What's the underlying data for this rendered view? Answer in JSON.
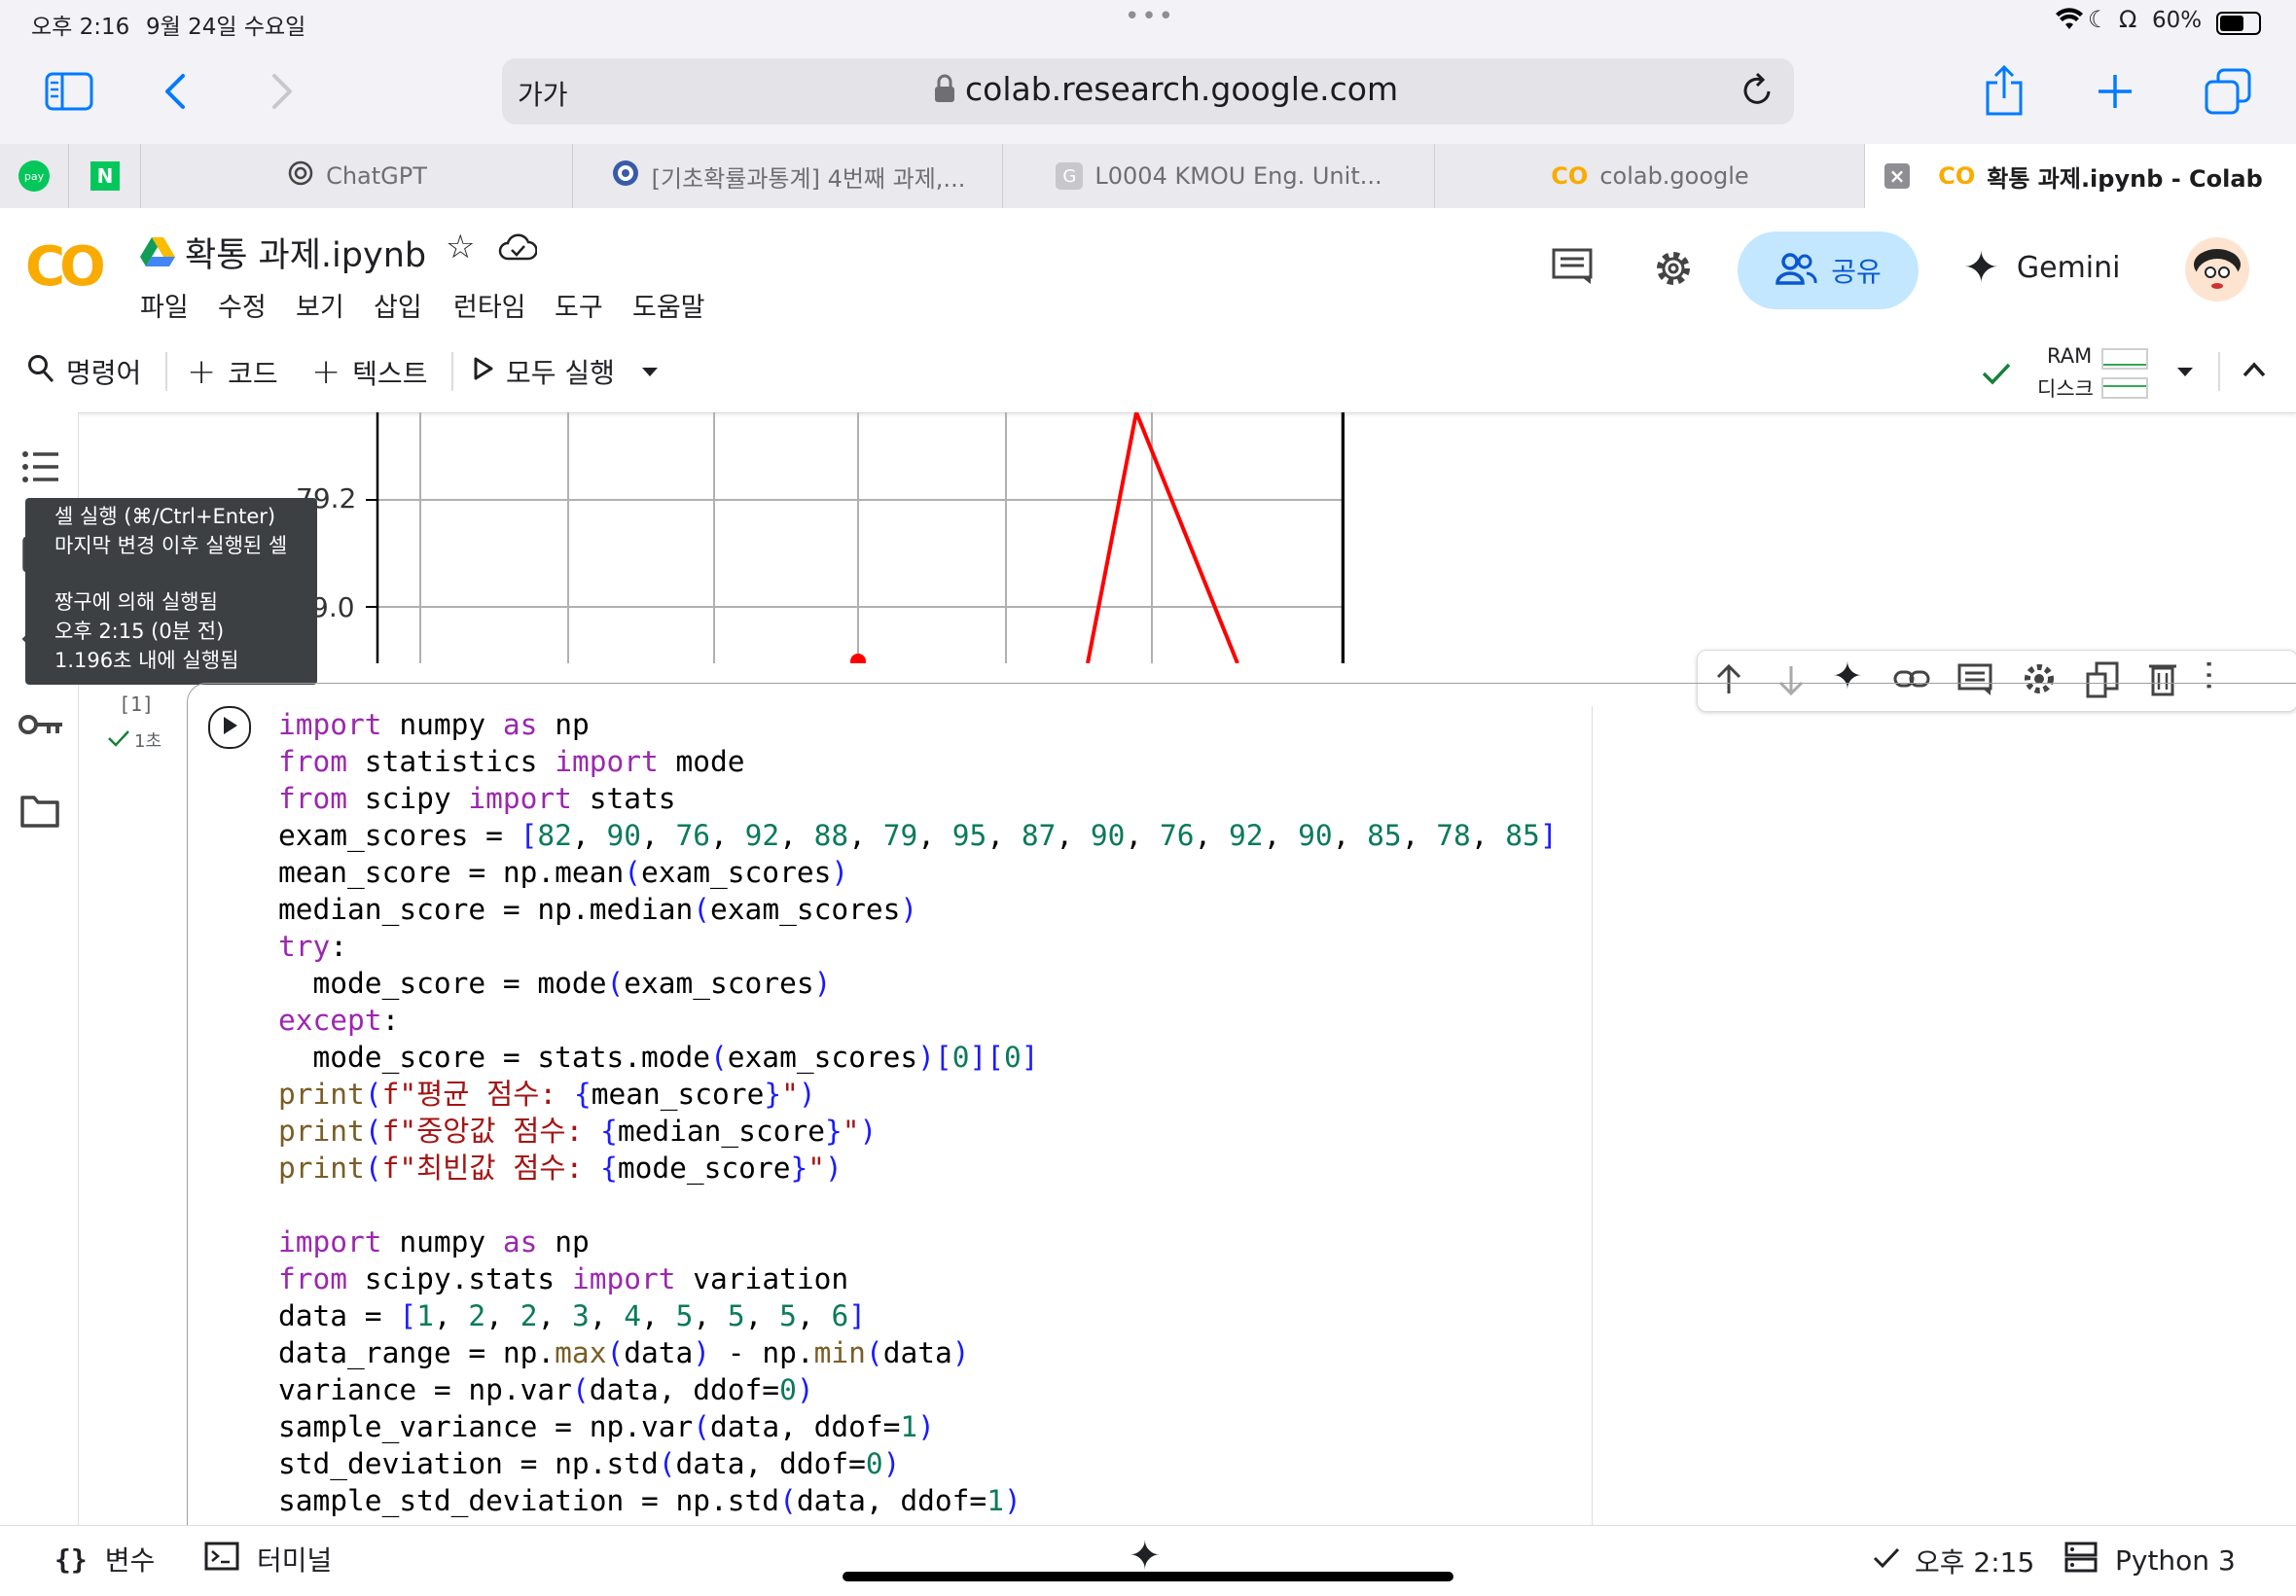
{
  "status": {
    "time": "오후 2:16",
    "date": "9월 24일 수요일",
    "battery": "60%"
  },
  "browser": {
    "aa_label": "가가",
    "url": "colab.research.google.com"
  },
  "tabs": [
    {
      "label": "ChatGPT"
    },
    {
      "label": "[기초확률과통계] 4번째 과제,..."
    },
    {
      "label": "L0004 KMOU Eng. Unit..."
    },
    {
      "label": "colab.google"
    },
    {
      "label": "확통 과제.ipynb - Colab"
    }
  ],
  "pinned": {
    "pay_label": "pay",
    "n_label": "N"
  },
  "colab": {
    "logo": "CO",
    "notebook_title": "확통 과제.ipynb",
    "menu": [
      "파일",
      "수정",
      "보기",
      "삽입",
      "런타임",
      "도구",
      "도움말"
    ],
    "share_label": "공유",
    "gemini_label": "Gemini"
  },
  "toolbar": {
    "command_label": "명령어",
    "code_label": "코드",
    "text_label": "텍스트",
    "run_all_label": "모두 실행",
    "ram_label": "RAM",
    "disk_label": "디스크"
  },
  "plot": {
    "tick_upper": "79.2",
    "tick_lower": "9.0",
    "line_color": "#ff0000"
  },
  "tooltip": {
    "line1": "셀 실행 (⌘/Ctrl+Enter)",
    "line2": "마지막 변경 이후 실행된 셀",
    "line3": "짱구에 의해 실행됨",
    "line4": "오후 2:15 (0분 전)",
    "line5": "1.196초 내에 실행됨"
  },
  "cell": {
    "exec_count": "[1]",
    "exec_time": "1초"
  },
  "bottom": {
    "variables_label": "변수",
    "terminal_label": "터미널",
    "status_time": "오후 2:15",
    "runtime_label": "Python 3"
  }
}
